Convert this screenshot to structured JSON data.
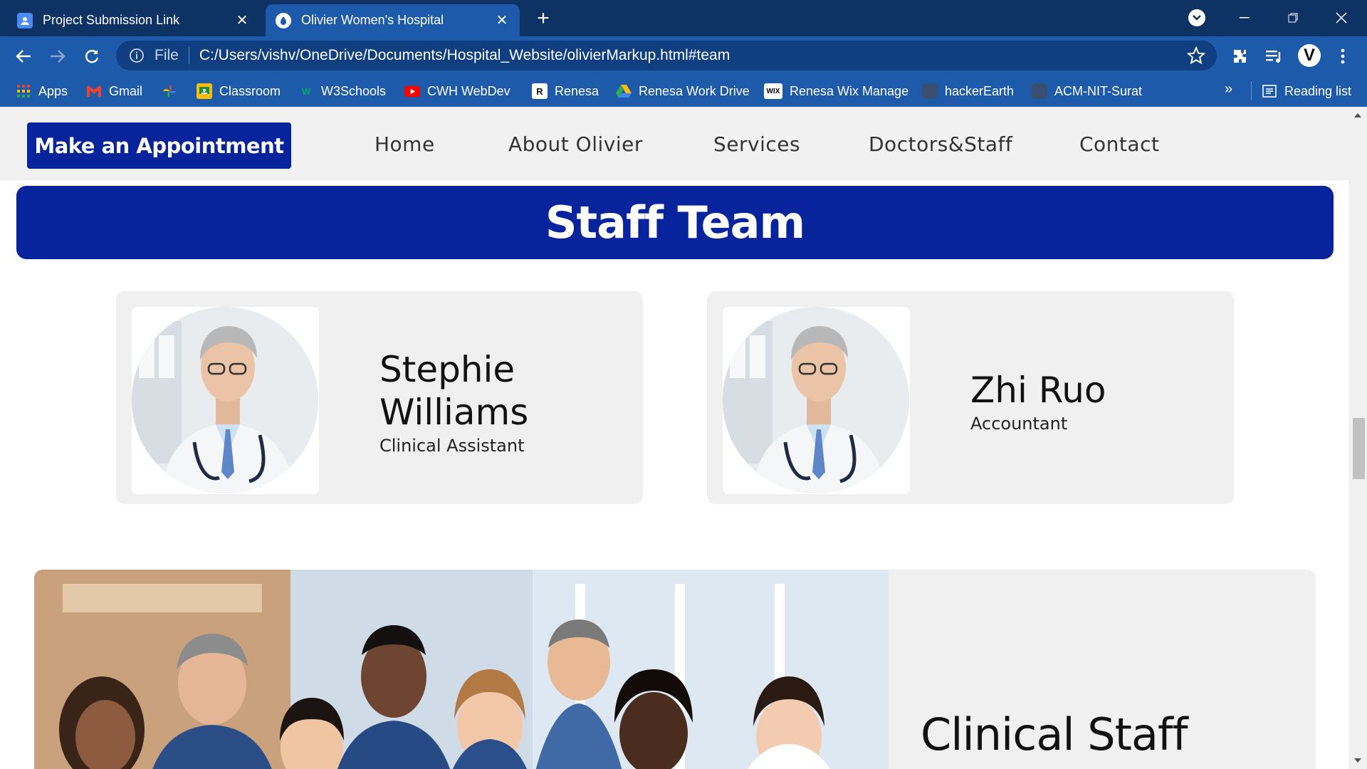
{
  "browser": {
    "tabs": [
      {
        "title": "Project Submission Link",
        "active": false
      },
      {
        "title": "Olivier Women's Hospital",
        "active": true
      }
    ],
    "address_bar": {
      "scheme_label": "File",
      "url": "C:/Users/vishv/OneDrive/Documents/Hospital_Website/olivierMarkup.html#team"
    },
    "profile_initial": "V",
    "bookmarks": [
      {
        "label": "Apps",
        "icon": "apps-grid-icon"
      },
      {
        "label": "Gmail",
        "icon": "gmail-icon"
      },
      {
        "label": "",
        "icon": "google-photos-icon"
      },
      {
        "label": "Classroom",
        "icon": "classroom-icon"
      },
      {
        "label": "W3Schools",
        "icon": "w3schools-icon"
      },
      {
        "label": "CWH WebDev",
        "icon": "youtube-icon"
      },
      {
        "label": "Renesa",
        "icon": "renesa-icon"
      },
      {
        "label": "Renesa Work Drive",
        "icon": "google-drive-icon"
      },
      {
        "label": "Renesa Wix Manage",
        "icon": "wix-icon"
      },
      {
        "label": "hackerEarth",
        "icon": "bookmark-page-icon"
      },
      {
        "label": "ACM-NIT-Surat",
        "icon": "bookmark-page-icon"
      }
    ],
    "bookmarks_overflow": "»",
    "reading_list_label": "Reading list",
    "colors": {
      "titlebar": "#0d3263",
      "toolbar": "#1d5aa9",
      "omnibox": "#0f3f80"
    }
  },
  "site": {
    "nav": {
      "cta_label": "Make an Appointment",
      "links": [
        "Home",
        "About Olivier",
        "Services",
        "Doctors&Staff",
        "Contact"
      ]
    },
    "banner_title": "Staff Team",
    "staff_cards": [
      {
        "name_line1": "Stephie",
        "name_line2": "Williams",
        "role": "Clinical Assistant"
      },
      {
        "name_line1": "Zhi Ruo",
        "name_line2": "",
        "role": "Accountant"
      }
    ],
    "group_section_title": "Clinical Staff",
    "colors": {
      "brand_blue": "#07249c",
      "card_bg": "#f0f0f0",
      "nav_bg": "#f1f1f1"
    }
  }
}
